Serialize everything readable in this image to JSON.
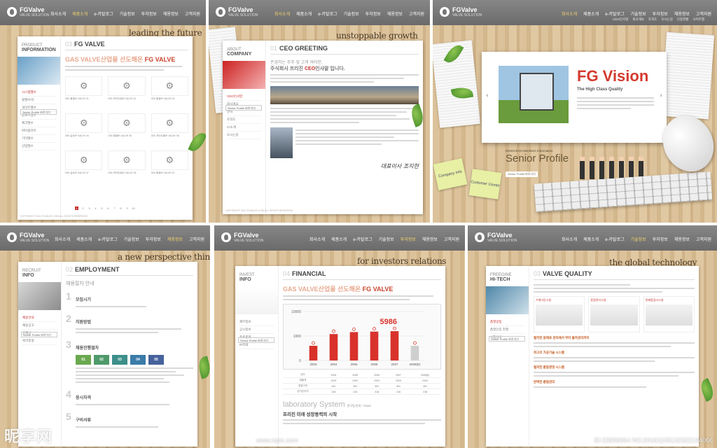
{
  "gnb": [
    "회사소개",
    "제품소개",
    "e-카탈로그",
    "기술정보",
    "투자정보",
    "채용정보",
    "고객지원"
  ],
  "util": [
    "HOME",
    "LOGIN",
    "JOIN",
    "SITEMAP",
    "CONTACT US"
  ],
  "logo": {
    "name": "FGValve",
    "tag": "VALVE SOLUTION"
  },
  "side_button": "Senior Profile 바로가기",
  "footer": "COPYRIGHT 2011 FGVALVE.COM ALL RIGHTS RESERVED",
  "p1": {
    "slogan": "leading the future",
    "side_title": "PRODUCT",
    "side_sub": "INFORMATION",
    "menu": [
      "시스템밸브",
      "볼밸브/유",
      "게이트밸브",
      "글로브밸브",
      "체크밸브",
      "버터플라이",
      "기타밸브",
      "산업밸브"
    ],
    "num": "03",
    "title": "FG VALVE",
    "headline_pre": "GAS VALVE산업을 선도해온",
    "headline_brand": "FG VALVE",
    "products": [
      "D50 볼밸브 VALVE 01",
      "D50 게이트밸브 VALVE 02",
      "D50 볼밸브 VALVE 03",
      "D50 글로브 VALVE 04",
      "D50 볼밸브 VALVE 05",
      "D50 게이트밸브 VALVE 06",
      "D50 글로브 VALVE 07",
      "D50 게이트밸브 VALVE 08",
      "D50 볼밸브 VALVE 09"
    ],
    "pages": [
      "1",
      "2",
      "3",
      "4",
      "5",
      "6",
      "7",
      "8",
      "9",
      "10"
    ]
  },
  "p2": {
    "slogan": "unstoppable growth",
    "side_title": "ABOUT",
    "side_sub": "COMPANY",
    "menu": [
      "CEO인사말",
      "회사개요",
      "연혁",
      "조직도",
      "CI소개",
      "오시는길"
    ],
    "num": "01",
    "title": "CEO GREETING",
    "greet1": "존경하는 주주 및 고객 여러분,",
    "greet2": "주식회사 프리진",
    "greet_em": "CEO",
    "greet3": "인사말 입니다.",
    "signature": "대표이사 조지현"
  },
  "p3": {
    "vision": "FG Vision",
    "vision_sub": "The High Class Quality",
    "senior_kicker": "INNOCEAN Members Information",
    "senior": "Senior Profile",
    "senior_btn": "Senior Profile 바로가기",
    "sticky1": "Company Info",
    "sticky2": "Customer Center",
    "subnav": [
      "CEO인사말",
      "회사개요",
      "조직도",
      "오시는길",
      "인증현황",
      "사이트맵"
    ]
  },
  "p4": {
    "slogan": "a new perspective think",
    "side_title": "RECRUIT",
    "side_sub": "INFO",
    "menu": [
      "채용안내",
      "채용공고",
      "인재상",
      "복리후생"
    ],
    "num": "02",
    "title": "EMPLOYMENT",
    "section": "채용절차 안내",
    "steps": [
      "모집시기",
      "지원방법",
      "채용진행절차",
      "응시자격",
      "구비서류"
    ],
    "boxes": [
      "01",
      "02",
      "03",
      "04",
      "05"
    ],
    "box_colors": [
      "#6aa84f",
      "#4f9a6b",
      "#3d8f8a",
      "#3a7ba8",
      "#46629b"
    ]
  },
  "p5": {
    "slogan": "for investors relations",
    "side_title": "INVEST",
    "side_sub": "INFO",
    "menu": [
      "재무정보",
      "공시정보",
      "주주총회",
      "IR자료"
    ],
    "num": "04",
    "title": "FINANCIAL",
    "headline_pre": "GAS VALVE산업을 선도해온",
    "headline_brand": "FG VALVE",
    "lab": "laboratory System",
    "lab_small": "연구팀 안내 / TEAM",
    "lab_k": "프리진 미래 성장동력의 시작"
  },
  "p6": {
    "slogan": "the global technology",
    "side_title": "FREEGINE",
    "side_sub": "HI-TECH",
    "menu": [
      "품질방침",
      "품질인증 현황",
      "시험설비"
    ],
    "num": "03",
    "title": "VALVE QUALITY",
    "cards": [
      "기계가공시설",
      "용접관리시설",
      "완제품검사시설"
    ],
    "bullets": [
      "철저한 원재료 관리에서 부터 출하관리까지",
      "최고의 가공기술 시스템",
      "철저한 품질경영 시스템",
      "완벽한 품질관리"
    ]
  },
  "chart_data": {
    "type": "bar",
    "categories": [
      "2003",
      "2004",
      "2005",
      "2006",
      "2007",
      "2008(E)"
    ],
    "series": [
      {
        "values": [
          3000,
          5400,
          5800,
          5900,
          5986,
          3000
        ]
      }
    ],
    "ylim": [
      0,
      10000
    ],
    "yticks": [
      "10000",
      "1000",
      "0"
    ],
    "highlight_label": "5986",
    "table_head": [
      "년도",
      "2004",
      "2005",
      "2006",
      "2007",
      "2008(E)"
    ],
    "table_rows": [
      [
        "매출액",
        "2329",
        "2329",
        "2329",
        "2329",
        "2329"
      ],
      [
        "영업이익",
        "351",
        "351",
        "351",
        "351",
        "351"
      ],
      [
        "당기순이익",
        "218",
        "218",
        "218",
        "218",
        "218"
      ]
    ]
  },
  "watermark": {
    "brand": "昵享网",
    "url": "www.nipic.com",
    "id": "ID:23596964 NO:20161105132322194066"
  }
}
